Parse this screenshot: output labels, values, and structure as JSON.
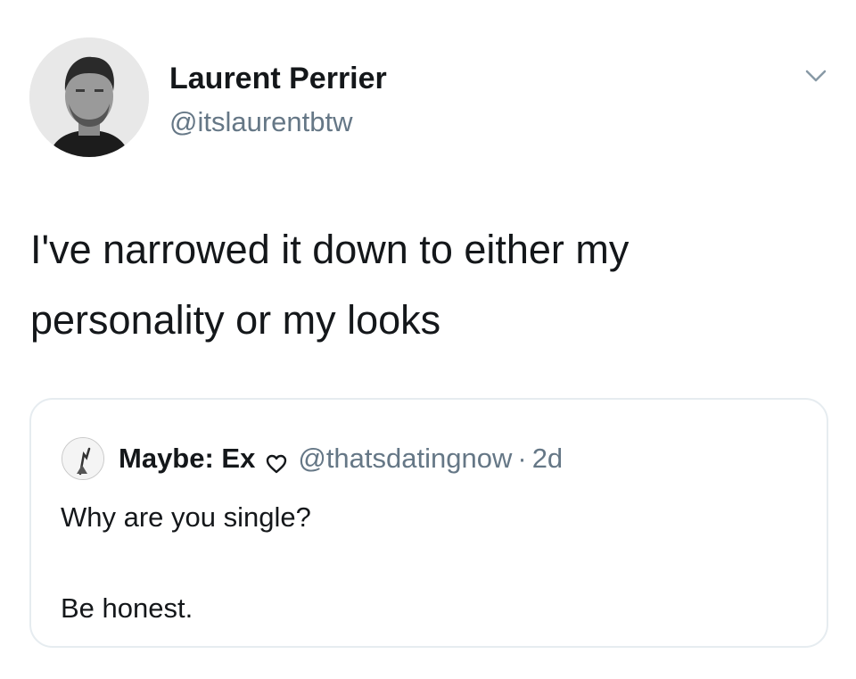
{
  "tweet": {
    "author": {
      "name": "Laurent Perrier",
      "handle": "@itslaurentbtw",
      "avatar_icon": "profile-photo"
    },
    "menu_icon": "chevron-down-icon",
    "text": "I've narrowed it down to either my\npersonality or my looks"
  },
  "quote": {
    "author_name": "Maybe: Ex",
    "heart_icon": "heart-outline-icon",
    "handle": "@thatsdatingnow",
    "separator": "·",
    "time": "2d",
    "line1": "Why are you single?",
    "line2": "Be honest."
  },
  "colors": {
    "text_primary": "#14171a",
    "text_secondary": "#657786",
    "border": "#e6ecf0",
    "background": "#ffffff"
  }
}
